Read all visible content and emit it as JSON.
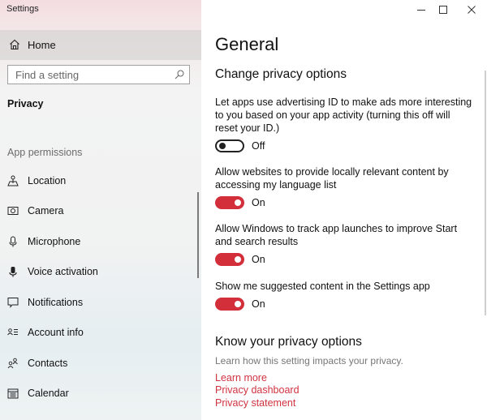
{
  "window": {
    "title": "Settings",
    "controls": {
      "minimize": "minimize-icon",
      "maximize": "maximize-icon",
      "close": "close-icon"
    }
  },
  "sidebar": {
    "home": {
      "label": "Home",
      "icon": "home-icon"
    },
    "search": {
      "placeholder": "Find a setting",
      "value": "",
      "icon": "search-icon"
    },
    "section_title": "Privacy",
    "group_label": "App permissions",
    "items": [
      {
        "label": "Location",
        "icon": "location-icon"
      },
      {
        "label": "Camera",
        "icon": "camera-icon"
      },
      {
        "label": "Microphone",
        "icon": "microphone-icon"
      },
      {
        "label": "Voice activation",
        "icon": "voice-activation-icon"
      },
      {
        "label": "Notifications",
        "icon": "notifications-icon"
      },
      {
        "label": "Account info",
        "icon": "account-info-icon"
      },
      {
        "label": "Contacts",
        "icon": "contacts-icon"
      },
      {
        "label": "Calendar",
        "icon": "calendar-icon"
      }
    ]
  },
  "main": {
    "title": "General",
    "change_section": {
      "heading": "Change privacy options",
      "settings": [
        {
          "description": "Let apps use advertising ID to make ads more interesting to you based on your app activity (turning this off will reset your ID.)",
          "state": "Off",
          "enabled": false
        },
        {
          "description": "Allow websites to provide locally relevant content by accessing my language list",
          "state": "On",
          "enabled": true
        },
        {
          "description": "Allow Windows to track app launches to improve Start and search results",
          "state": "On",
          "enabled": true
        },
        {
          "description": "Show me suggested content in the Settings app",
          "state": "On",
          "enabled": true
        }
      ]
    },
    "know_section": {
      "heading": "Know your privacy options",
      "subtext": "Learn how this setting impacts your privacy.",
      "links": [
        "Learn more",
        "Privacy dashboard",
        "Privacy statement"
      ]
    }
  },
  "colors": {
    "accent": "#d32f3b",
    "link": "#d0323f",
    "muted_text": "#767676"
  }
}
